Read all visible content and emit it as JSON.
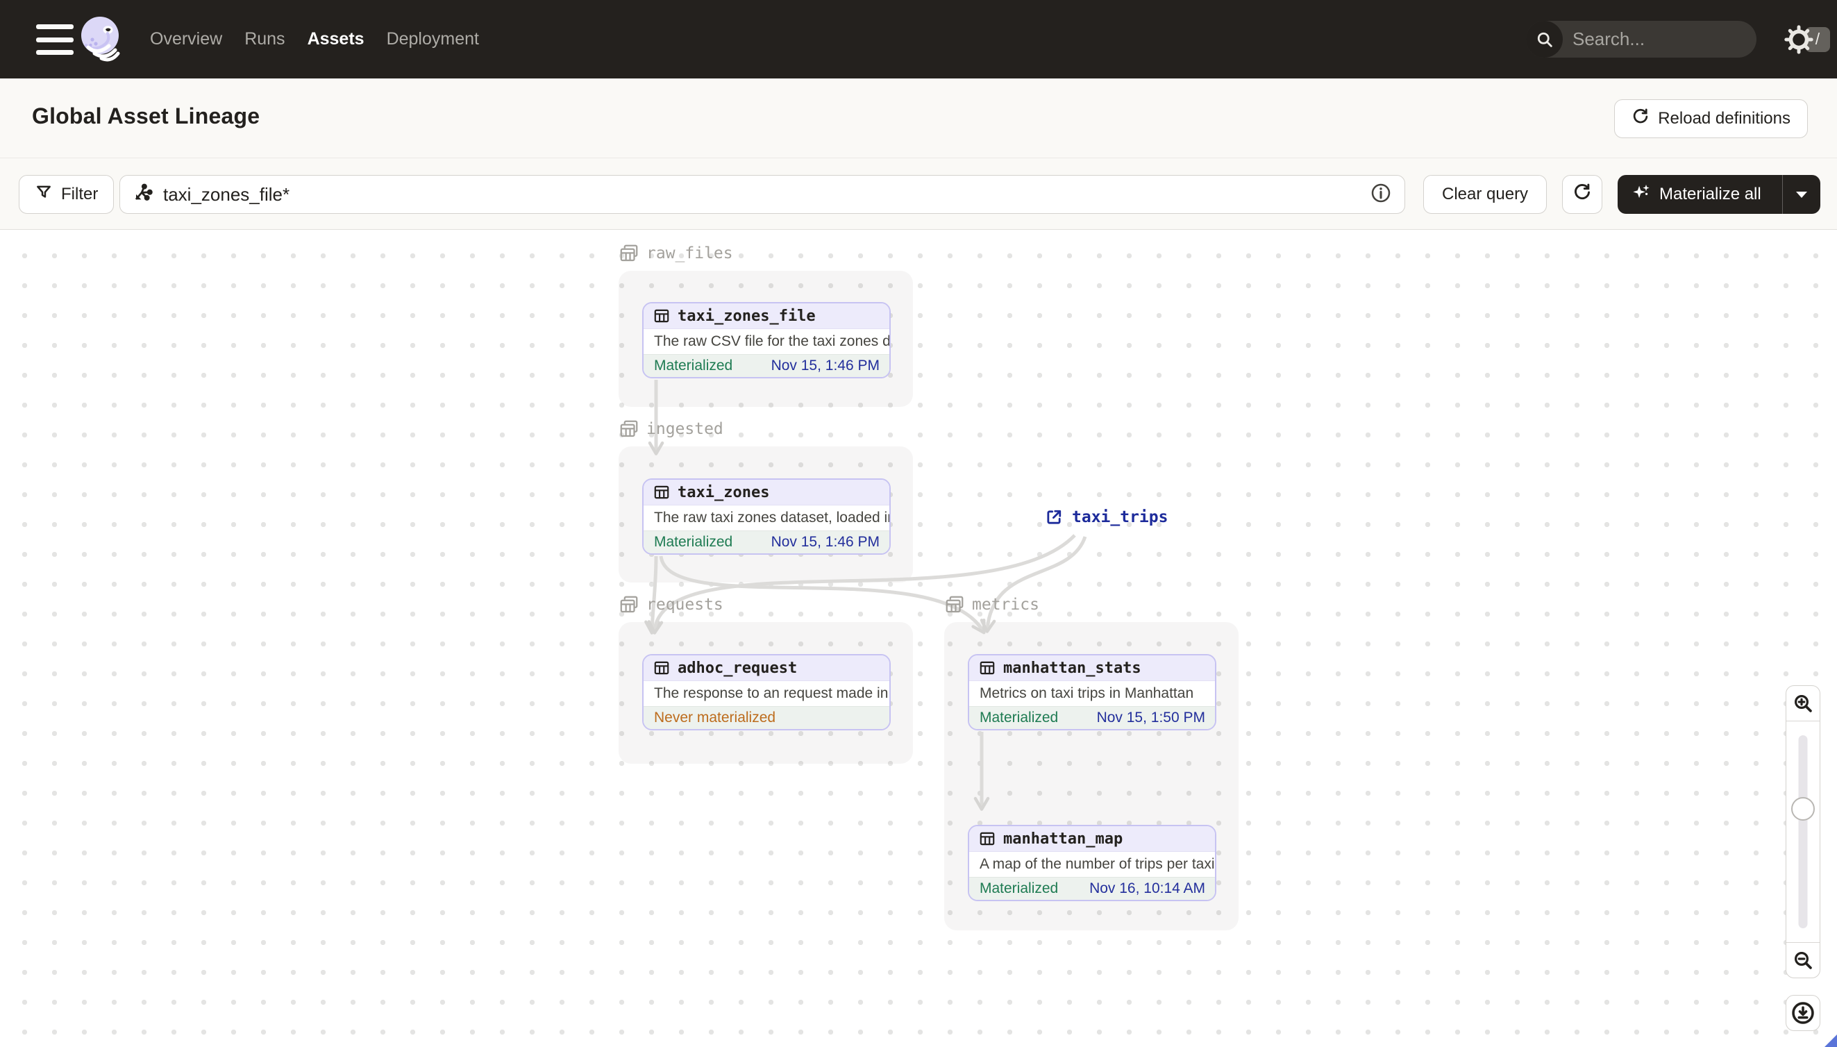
{
  "nav": {
    "items": [
      {
        "label": "Overview",
        "active": false
      },
      {
        "label": "Runs",
        "active": false
      },
      {
        "label": "Assets",
        "active": true
      },
      {
        "label": "Deployment",
        "active": false
      }
    ],
    "search": {
      "placeholder": "Search...",
      "shortcut": "/"
    }
  },
  "header": {
    "title": "Global Asset Lineage",
    "reload_button": "Reload definitions"
  },
  "toolbar": {
    "filter_button": "Filter",
    "query_value": "taxi_zones_file*",
    "clear_button": "Clear query",
    "materialize_button": "Materialize all"
  },
  "graph": {
    "groups": [
      {
        "name": "raw_files"
      },
      {
        "name": "ingested"
      },
      {
        "name": "requests"
      },
      {
        "name": "metrics"
      }
    ],
    "nodes": [
      {
        "name": "taxi_zones_file",
        "description": "The raw CSV file for the taxi zones dat...",
        "status": "Materialized",
        "timestamp": "Nov 15, 1:46 PM"
      },
      {
        "name": "taxi_zones",
        "description": "The raw taxi zones dataset, loaded int...",
        "status": "Materialized",
        "timestamp": "Nov 15, 1:46 PM"
      },
      {
        "name": "adhoc_request",
        "description": "The response to an request made in th...",
        "status": "Never materialized",
        "timestamp": ""
      },
      {
        "name": "manhattan_stats",
        "description": "Metrics on taxi trips in Manhattan",
        "status": "Materialized",
        "timestamp": "Nov 15, 1:50 PM"
      },
      {
        "name": "manhattan_map",
        "description": "A map of the number of trips per taxi z...",
        "status": "Materialized",
        "timestamp": "Nov 16, 10:14 AM"
      }
    ],
    "external_node": {
      "name": "taxi_trips"
    }
  },
  "icons": {
    "hamburger-icon": "menu bars",
    "dagster-logo": "octopus swirl",
    "search-icon": "magnifier",
    "gear-icon": "settings gear",
    "refresh-icon": "circular arrow",
    "filter-icon": "funnel",
    "lineage-query-icon": "fan-out arrow with dots",
    "info-icon": "circled i",
    "sparkle-icon": "stars",
    "caret-down-icon": "triangle down",
    "table-icon": "data table grid",
    "group-icon": "layered tables",
    "external-link-icon": "box with outgoing arrow",
    "zoom-in-icon": "magnifier plus",
    "zoom-out-icon": "magnifier minus",
    "download-icon": "circled down arrow"
  },
  "colors": {
    "topbar": "#24211E",
    "band": "#FAF9F6",
    "node_border": "#C7C3F2",
    "node_header": "#EDEBFB",
    "status_green": "#1E7B52",
    "status_orange": "#BD6C1D",
    "timestamp_navy": "#232F9C",
    "external_navy": "#1D2B9B",
    "edge_gray": "#DCDBD9"
  }
}
